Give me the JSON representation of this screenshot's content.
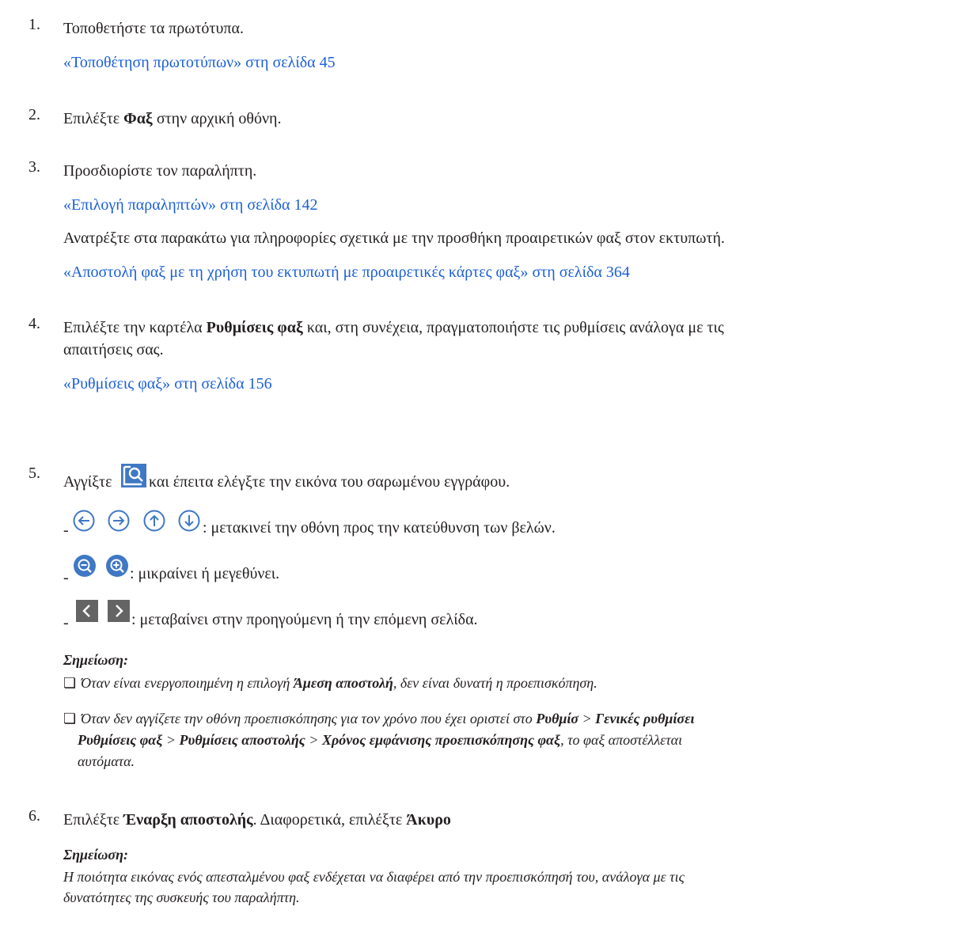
{
  "steps": [
    {
      "number": "1.",
      "text": "Τοποθετήστε τα πρωτότυπα.",
      "link": "«Τοποθέτηση πρωτοτύπων» στη σελίδα 45"
    },
    {
      "number": "2.",
      "pre": "Επιλέξτε ",
      "bold": "Φαξ",
      "post": " στην αρχική οθόνη."
    },
    {
      "number": "3.",
      "text": "Προσδιορίστε τον παραλήπτη.",
      "link": "«Επιλογή παραληπτών» στη σελίδα 142",
      "extra_text": "Ανατρέξτε στα παρακάτω για πληροφορίες σχετικά με την προσθήκη προαιρετικών φαξ στον εκτυπωτή.",
      "extra_link": "«Αποστολή φαξ με τη χρήση του εκτυπωτή με προαιρετικές κάρτες φαξ» στη σελίδα 364"
    },
    {
      "number": "4.",
      "pre": "Επιλέξτε την καρτέλα ",
      "bold": "Ρυθμίσεις φαξ",
      "post": " και, στη συνέχεια, πραγματοποιήστε τις ρυθμίσεις ανάλογα με τις",
      "line2": "απαιτήσεις σας.",
      "link": "«Ρυθμίσεις φαξ» στη σελίδα 156"
    },
    {
      "number": "5.",
      "pre": "Αγγίξτε ",
      "post": " και έπειτα ελέγξτε την εικόνα του σαρωμένου εγγράφου.",
      "icon": "preview-zoom-icon",
      "bullets": [
        {
          "dash": "-",
          "icons": [
            "arrow-left-circle-icon",
            "arrow-right-circle-icon",
            "arrow-up-circle-icon",
            "arrow-down-circle-icon"
          ],
          "text": ": μετακινεί την οθόνη προς την κατεύθυνση των βελών."
        },
        {
          "dash": "-",
          "icons": [
            "zoom-out-icon",
            "zoom-in-icon"
          ],
          "text": ": μικραίνει ή μεγεθύνει."
        },
        {
          "dash": "-",
          "icons": [
            "prev-page-icon",
            "next-page-icon"
          ],
          "text": ": μεταβαίνει στην προηγούμενη ή την επόμενη σελίδα."
        }
      ],
      "note_heading": "Σημείωση:",
      "note_items": [
        {
          "box": "❏",
          "pre": "Όταν είναι ενεργοποιημένη η επιλογή ",
          "bold": "Άμεση αποστολή",
          "post": ", δεν είναι δυνατή η προεπισκόπηση."
        },
        {
          "box": "❏",
          "line1_pre": "Όταν δεν αγγίζετε την οθόνη προεπισκόπησης για τον χρόνο που έχει οριστεί στο ",
          "line1_b1": "Ρυθμίσ",
          "line1_sep": " > ",
          "line1_b2": "Γενικές ρυθμίσει",
          "line2_b1": "Ρυθμίσεις φαξ",
          "line2_sep1": " > ",
          "line2_b2": "Ρυθμίσεις αποστολής",
          "line2_sep2": " > ",
          "line2_b3": "Χρόνος εμφάνισης προεπισκόπησης φαξ",
          "line2_post": ", το φαξ αποστέλλεται",
          "line3": "αυτόματα."
        }
      ]
    },
    {
      "number": "6.",
      "pre": "Επιλέξτε ",
      "bold": "Έναρξη αποστολής",
      "mid": ". Διαφορετικά, επιλέξτε ",
      "bold2": "Άκυρο",
      "note_heading": "Σημείωση:",
      "note_line1": "Η ποιότητα εικόνας ενός απεσταλμένου φαξ ενδέχεται να διαφέρει από την προεπισκόπησή του, ανάλογα με τις",
      "note_line2": "δυνατότητες της συσκευής του παραλήπτη."
    }
  ],
  "colors": {
    "link": "#1a5fd8",
    "icon_fill": "#3f78c4",
    "nav_fill": "#646464",
    "text": "#231f20"
  }
}
